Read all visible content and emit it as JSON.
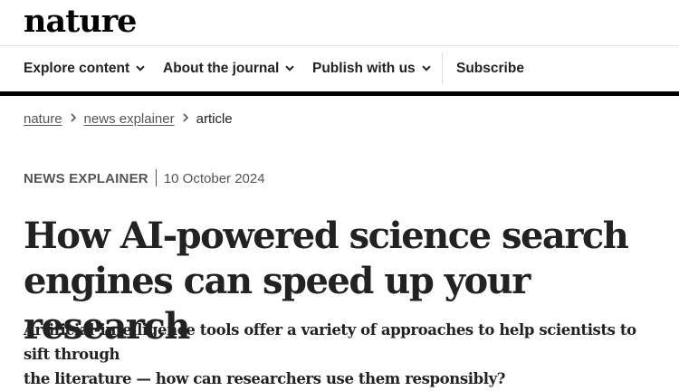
{
  "site": {
    "logo": "nature"
  },
  "nav": {
    "explore_label": "Explore content",
    "about_label": "About the journal",
    "publish_label": "Publish with us",
    "subscribe_label": "Subscribe",
    "dropdown_icon": "chevron-down-icon"
  },
  "breadcrumb": {
    "items": [
      "nature",
      "news explainer"
    ],
    "current": "article",
    "separator_icon": "chevron-right-icon"
  },
  "article": {
    "type": "NEWS EXPLAINER",
    "date": "10 October 2024",
    "headline_line1": "How AI-powered science search",
    "headline_line2": "engines can speed up your research",
    "standfirst_line1": "Artificial-intelligence tools offer a variety of approaches to help scientists to sift through",
    "standfirst_line2": "the literature — how can researchers use them responsibly?"
  },
  "colors": {
    "text": "#222222",
    "muted": "#555555",
    "rule": "#000000",
    "divider": "#e4e4e4"
  }
}
